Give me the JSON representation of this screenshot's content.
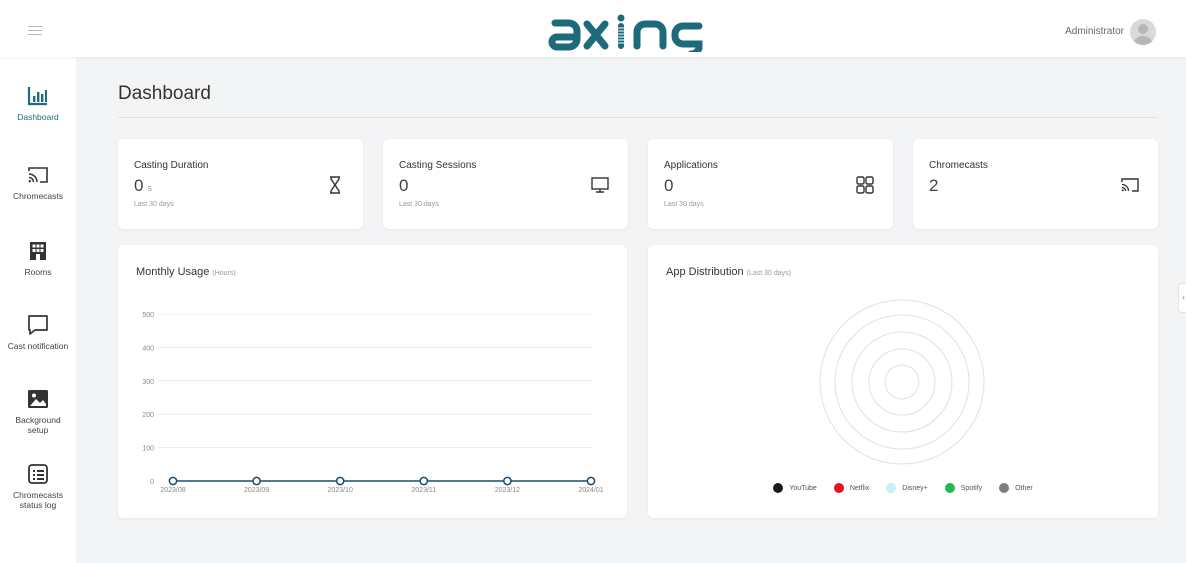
{
  "header": {
    "menu_icon": "hamburger-icon",
    "logo_text": "axing",
    "user_label": "Administrator",
    "avatar_icon": "user-avatar-icon",
    "brand_color": "#1d6b7a"
  },
  "sidebar": {
    "items": [
      {
        "label": "Dashboard",
        "icon": "bar-chart-icon",
        "active": true
      },
      {
        "label": "Chromecasts",
        "icon": "cast-icon"
      },
      {
        "label": "Rooms",
        "icon": "building-icon"
      },
      {
        "label": "Cast notification",
        "icon": "message-icon"
      },
      {
        "label": "Background setup",
        "icon": "image-icon"
      },
      {
        "label": "Chromecasts status log",
        "icon": "list-icon"
      }
    ]
  },
  "main": {
    "title": "Dashboard",
    "stats": [
      {
        "title": "Casting Duration",
        "value": "0",
        "unit": "s",
        "sub": "Last 30 days",
        "icon": "hourglass-icon"
      },
      {
        "title": "Casting Sessions",
        "value": "0",
        "unit": "",
        "sub": "Last 30 days",
        "icon": "monitor-icon"
      },
      {
        "title": "Applications",
        "value": "0",
        "unit": "",
        "sub": "Last 30 days",
        "icon": "grid-icon"
      },
      {
        "title": "Chromecasts",
        "value": "2",
        "unit": "",
        "sub": "",
        "icon": "cast-icon"
      }
    ],
    "monthly_usage": {
      "title": "Monthly Usage",
      "subtitle": "(Hours)"
    },
    "app_distribution": {
      "title": "App Distribution",
      "subtitle": "(Last 30 days)",
      "legend": [
        {
          "label": "YouTube",
          "color": "#1a1a1a"
        },
        {
          "label": "Netflix",
          "color": "#e8101c"
        },
        {
          "label": "Disney+",
          "color": "#c9eef5"
        },
        {
          "label": "Spotify",
          "color": "#1fba52"
        },
        {
          "label": "Other",
          "color": "#7d7d7d"
        }
      ]
    }
  },
  "chart_data": [
    {
      "type": "line",
      "title": "Monthly Usage",
      "subtitle": "(Hours)",
      "x": [
        "2023/08",
        "2023/09",
        "2023/10",
        "2023/11",
        "2023/12",
        "2024/01"
      ],
      "y_ticks": [
        0,
        100,
        200,
        300,
        400,
        500
      ],
      "ylim": [
        0,
        500
      ],
      "series": [
        {
          "values": [
            0,
            0,
            0,
            0,
            0,
            0
          ],
          "color": "#1d4b6e"
        }
      ],
      "grid": true
    },
    {
      "type": "pie",
      "title": "App Distribution",
      "subtitle": "(Last 30 days)",
      "labels": [
        "YouTube",
        "Netflix",
        "Disney+",
        "Spotify",
        "Other"
      ],
      "values": [
        0,
        0,
        0,
        0,
        0
      ],
      "legend": "bottom"
    }
  ]
}
